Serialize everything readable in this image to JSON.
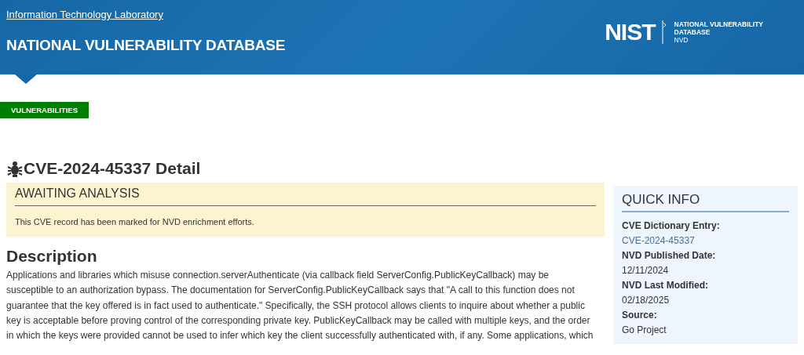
{
  "header": {
    "org_link": "Information Technology Laboratory",
    "title": "NATIONAL VULNERABILITY DATABASE",
    "logo": {
      "mark": "NIST",
      "line_1": "NATIONAL VULNERABILITY",
      "line_2": "DATABASE",
      "line_3": "NVD"
    }
  },
  "breadcrumb": "VULNERABILITIES",
  "page_title": "CVE-2024-45337 Detail",
  "notice": {
    "heading": "AWAITING ANALYSIS",
    "text": "This CVE record has been marked for NVD enrichment efforts."
  },
  "description": {
    "heading": "Description",
    "text": "Applications and libraries which misuse connection.serverAuthenticate (via callback field ServerConfig.PublicKeyCallback) may be susceptible to an authorization bypass. The documentation for ServerConfig.PublicKeyCallback says that \"A call to this function does not guarantee that the key offered is in fact used to authenticate.\" Specifically, the SSH protocol allows clients to inquire about whether a public key is acceptable before proving control of the corresponding private key. PublicKeyCallback may be called with multiple keys, and the order in which the keys were provided cannot be used to infer which key the client successfully authenticated with, if any. Some applications, which"
  },
  "quick_info": {
    "heading": "QUICK INFO",
    "fields": [
      {
        "label": "CVE Dictionary Entry:",
        "value": "CVE-2024-45337",
        "kind": "link"
      },
      {
        "label": "NVD Published Date:",
        "value": "12/11/2024",
        "kind": "text"
      },
      {
        "label": "NVD Last Modified:",
        "value": "02/18/2025",
        "kind": "text"
      },
      {
        "label": "Source:",
        "value": "Go Project",
        "kind": "text"
      }
    ]
  }
}
